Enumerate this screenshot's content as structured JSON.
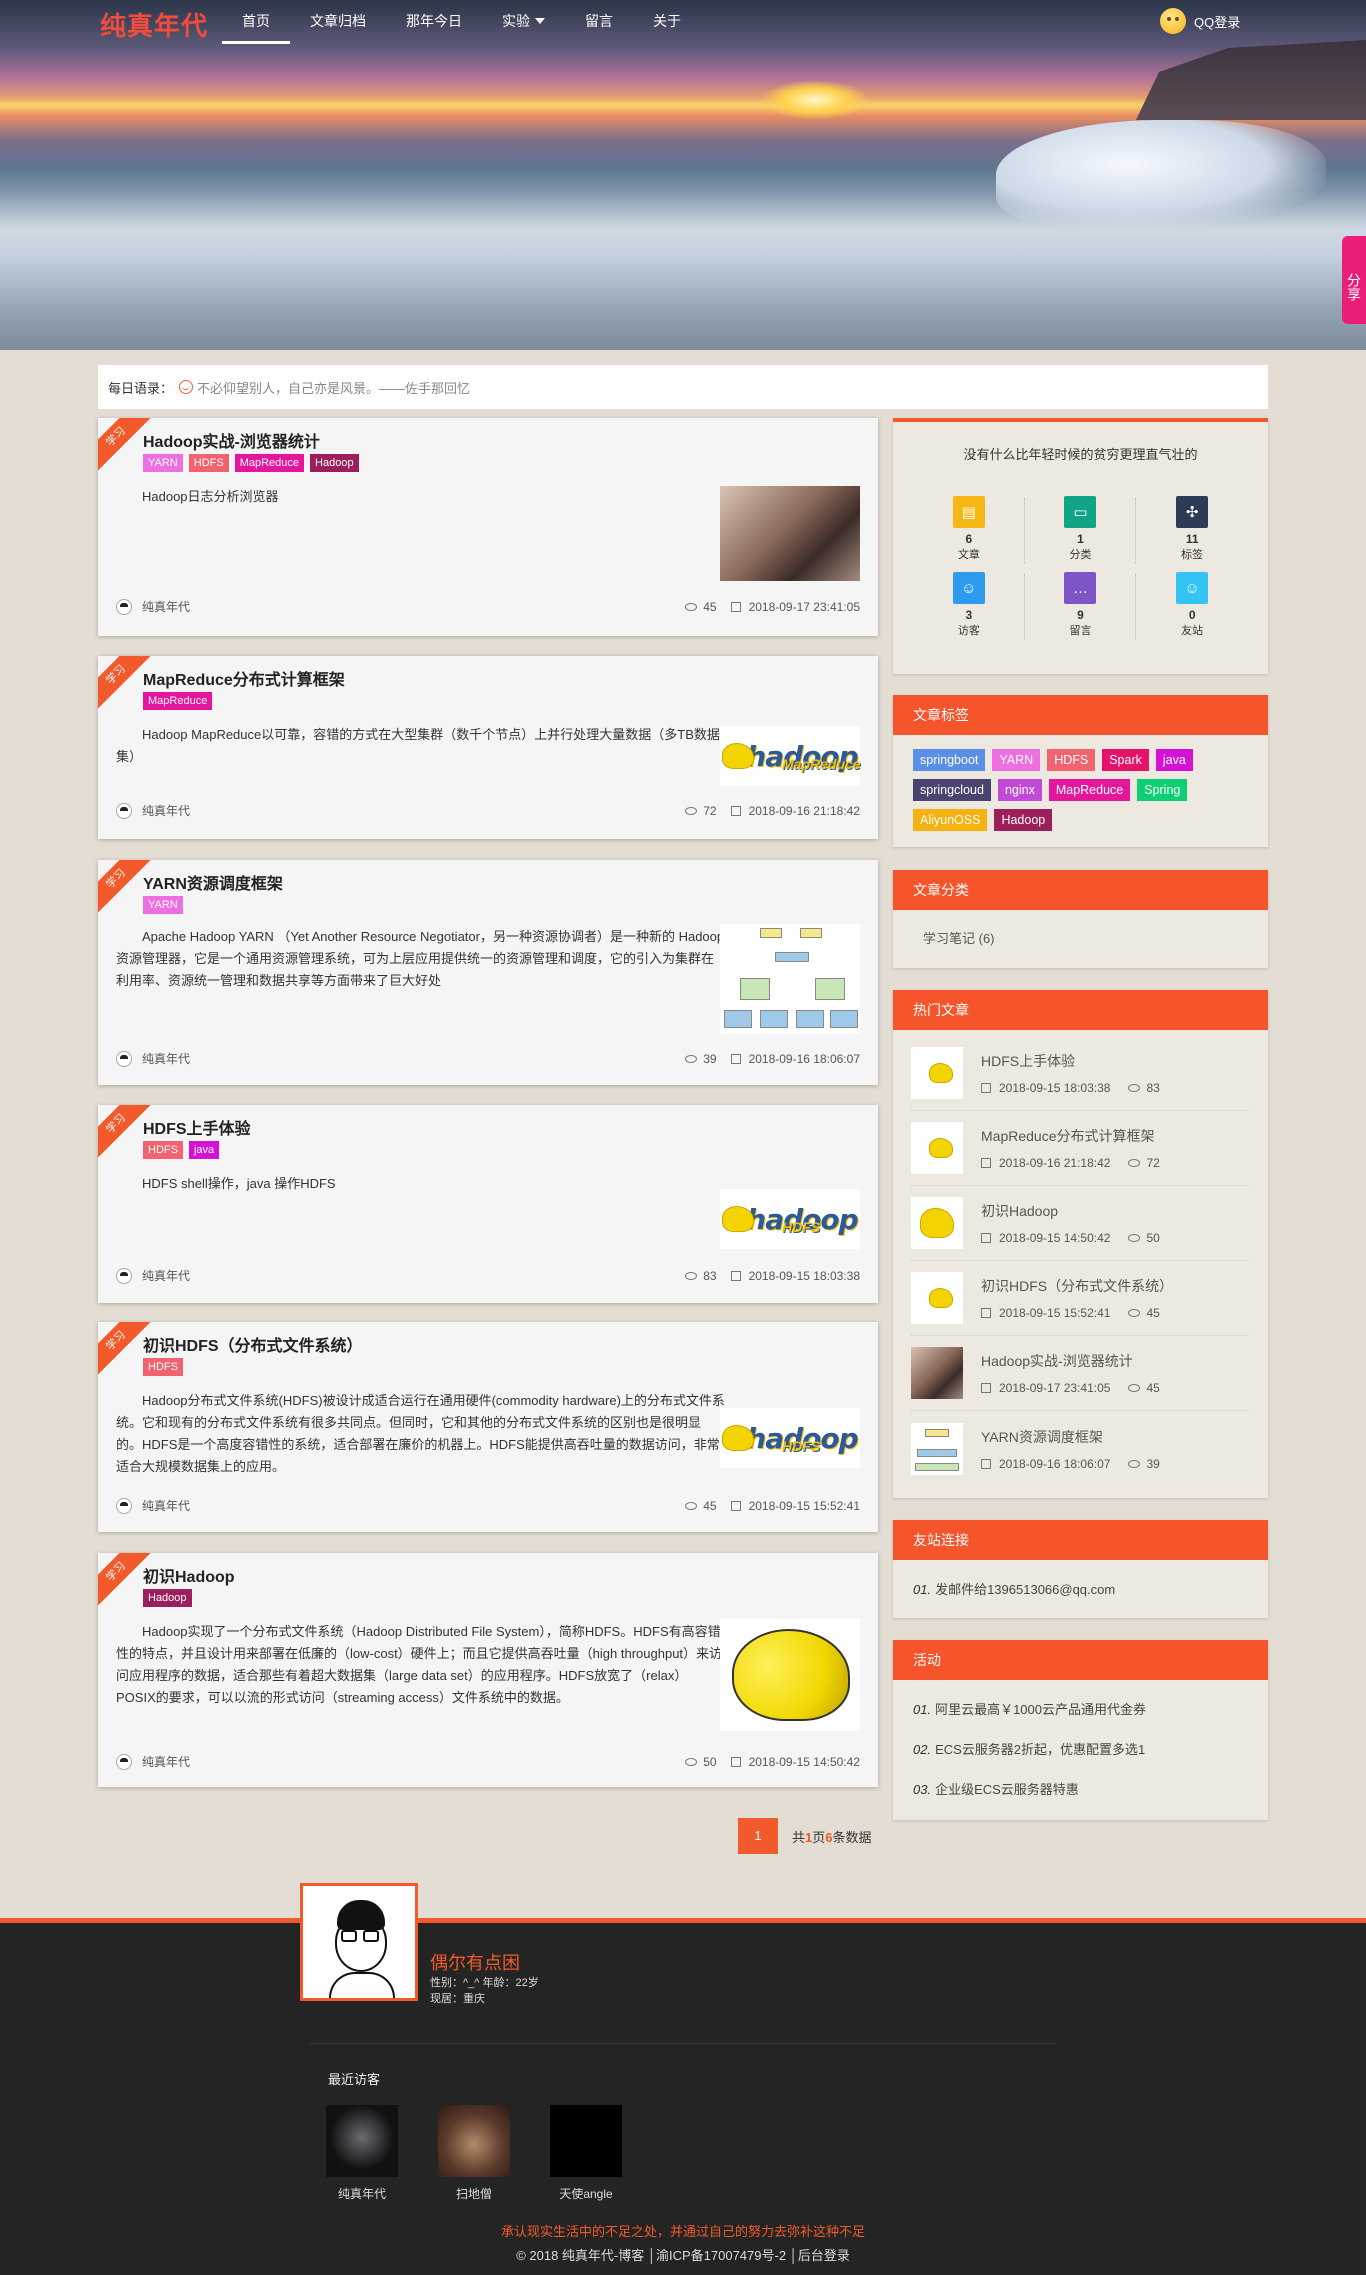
{
  "nav": {
    "logo": "纯真年代",
    "menu": [
      "首页",
      "文章归档",
      "那年今日",
      "实验",
      "留言",
      "关于"
    ],
    "login": "QQ登录",
    "share": "分享"
  },
  "motto": {
    "label": "每日语录：",
    "text": "不必仰望别人，自己亦是风景。——佐手那回忆"
  },
  "articles": [
    {
      "category": "学习",
      "title": "Hadoop实战-浏览器统计",
      "tags": [
        {
          "name": "YARN",
          "color": "#ee6fdf"
        },
        {
          "name": "HDFS",
          "color": "#f0636f"
        },
        {
          "name": "MapReduce",
          "color": "#e6169c"
        },
        {
          "name": "Hadoop",
          "color": "#9c1e5a"
        }
      ],
      "excerpt": "Hadoop日志分析浏览器",
      "author": "纯真年代",
      "views": "45",
      "date": "2018-09-17 23:41:05"
    },
    {
      "category": "学习",
      "title": "MapReduce分布式计算框架",
      "tags": [
        {
          "name": "MapReduce",
          "color": "#e6169c"
        }
      ],
      "excerpt": "Hadoop MapReduce以可靠，容错的方式在大型集群（数千个节点）上并行处理大量数据（多TB数据集）",
      "author": "纯真年代",
      "views": "72",
      "date": "2018-09-16 21:18:42"
    },
    {
      "category": "学习",
      "title": "YARN资源调度框架",
      "tags": [
        {
          "name": "YARN",
          "color": "#ee6fdf"
        }
      ],
      "excerpt": "Apache Hadoop YARN （Yet Another Resource Negotiator，另一种资源协调者）是一种新的 Hadoop 资源管理器，它是一个通用资源管理系统，可为上层应用提供统一的资源管理和调度，它的引入为集群在利用率、资源统一管理和数据共享等方面带来了巨大好处",
      "author": "纯真年代",
      "views": "39",
      "date": "2018-09-16 18:06:07"
    },
    {
      "category": "学习",
      "title": "HDFS上手体验",
      "tags": [
        {
          "name": "HDFS",
          "color": "#f0636f"
        },
        {
          "name": "java",
          "color": "#d312d6"
        }
      ],
      "excerpt": "HDFS shell操作，java 操作HDFS",
      "author": "纯真年代",
      "views": "83",
      "date": "2018-09-15 18:03:38"
    },
    {
      "category": "学习",
      "title": "初识HDFS（分布式文件系统）",
      "tags": [
        {
          "name": "HDFS",
          "color": "#f0636f"
        }
      ],
      "excerpt": "Hadoop分布式文件系统(HDFS)被设计成适合运行在通用硬件(commodity hardware)上的分布式文件系统。它和现有的分布式文件系统有很多共同点。但同时，它和其他的分布式文件系统的区别也是很明显的。HDFS是一个高度容错性的系统，适合部署在廉价的机器上。HDFS能提供高吞吐量的数据访问，非常适合大规模数据集上的应用。",
      "author": "纯真年代",
      "views": "45",
      "date": "2018-09-15 15:52:41"
    },
    {
      "category": "学习",
      "title": "初识Hadoop",
      "tags": [
        {
          "name": "Hadoop",
          "color": "#9c1e5a"
        }
      ],
      "excerpt": "Hadoop实现了一个分布式文件系统（Hadoop Distributed File System），简称HDFS。HDFS有高容错性的特点，并且设计用来部署在低廉的（low-cost）硬件上；而且它提供高吞吐量（high throughput）来访问应用程序的数据，适合那些有着超大数据集（large data set）的应用程序。HDFS放宽了（relax）POSIX的要求，可以以流的形式访问（streaming access）文件系统中的数据。",
      "author": "纯真年代",
      "views": "50",
      "date": "2018-09-15 14:50:42"
    }
  ],
  "hadoop_word": "hadoop",
  "thumb_sub": {
    "mr": "MapReduce",
    "hdfs": "HDFS"
  },
  "pager": {
    "current": "1",
    "info_pre": "共",
    "pages": "1",
    "info_mid": "页",
    "count": "6",
    "info_post": "条数据"
  },
  "sidebar": {
    "slogan": "没有什么比年轻时候的贫穷更理直气壮的",
    "stats": [
      {
        "num": "6",
        "label": "文章",
        "color": "#f6b613",
        "icon": "doc-icon"
      },
      {
        "num": "1",
        "label": "分类",
        "color": "#11a486",
        "icon": "folder-icon"
      },
      {
        "num": "11",
        "label": "标签",
        "color": "#2b3a55",
        "icon": "tag-icon"
      },
      {
        "num": "3",
        "label": "访客",
        "color": "#2d9bf0",
        "icon": "user-icon"
      },
      {
        "num": "9",
        "label": "留言",
        "color": "#7d55c7",
        "icon": "comment-icon"
      },
      {
        "num": "0",
        "label": "友站",
        "color": "#34c3f2",
        "icon": "smile-icon"
      }
    ],
    "tags_title": "文章标签",
    "tagcloud": [
      {
        "name": "springboot",
        "color": "#5b8ee8"
      },
      {
        "name": "YARN",
        "color": "#ee6fdf"
      },
      {
        "name": "HDFS",
        "color": "#f0636f"
      },
      {
        "name": "Spark",
        "color": "#e6126a"
      },
      {
        "name": "java",
        "color": "#d312d6"
      },
      {
        "name": "springcloud",
        "color": "#4b4370"
      },
      {
        "name": "nginx",
        "color": "#c34ad6"
      },
      {
        "name": "MapReduce",
        "color": "#e6169c"
      },
      {
        "name": "Spring",
        "color": "#0fcf75"
      },
      {
        "name": "AliyunOSS",
        "color": "#f7b212"
      },
      {
        "name": "Hadoop",
        "color": "#9c1e5a"
      }
    ],
    "cat_title": "文章分类",
    "categories": [
      "学习笔记 (6)"
    ],
    "hot_title": "热门文章",
    "hot": [
      {
        "title": "HDFS上手体验",
        "date": "2018-09-15 18:03:38",
        "views": "83"
      },
      {
        "title": "MapReduce分布式计算框架",
        "date": "2018-09-16 21:18:42",
        "views": "72"
      },
      {
        "title": "初识Hadoop",
        "date": "2018-09-15 14:50:42",
        "views": "50"
      },
      {
        "title": "初识HDFS（分布式文件系统）",
        "date": "2018-09-15 15:52:41",
        "views": "45"
      },
      {
        "title": "Hadoop实战-浏览器统计",
        "date": "2018-09-17 23:41:05",
        "views": "45"
      },
      {
        "title": "YARN资源调度框架",
        "date": "2018-09-16 18:06:07",
        "views": "39"
      }
    ],
    "links_title": "友站连接",
    "links": [
      {
        "no": "01.",
        "text": "发邮件给1396513066@qq.com"
      }
    ],
    "act_title": "活动",
    "acts": [
      {
        "no": "01.",
        "text": "阿里云最高￥1000云产品通用代金券"
      },
      {
        "no": "02.",
        "text": "ECS云服务器2折起，优惠配置多选1"
      },
      {
        "no": "03.",
        "text": "企业级ECS云服务器特惠"
      }
    ]
  },
  "footer": {
    "name": "偶尔有点困",
    "info1": "性别：^_^ 年龄：22岁",
    "info2": "现居：重庆",
    "recent_title": "最近访客",
    "visitors": [
      "纯真年代",
      "扫地僧",
      "天使angle"
    ],
    "slogan": "承认现实生活中的不足之处，并通过自己的努力去弥补这种不足",
    "copyright": "© 2018 纯真年代-博客 │渝ICP备17007479号-2 │后台登录"
  }
}
